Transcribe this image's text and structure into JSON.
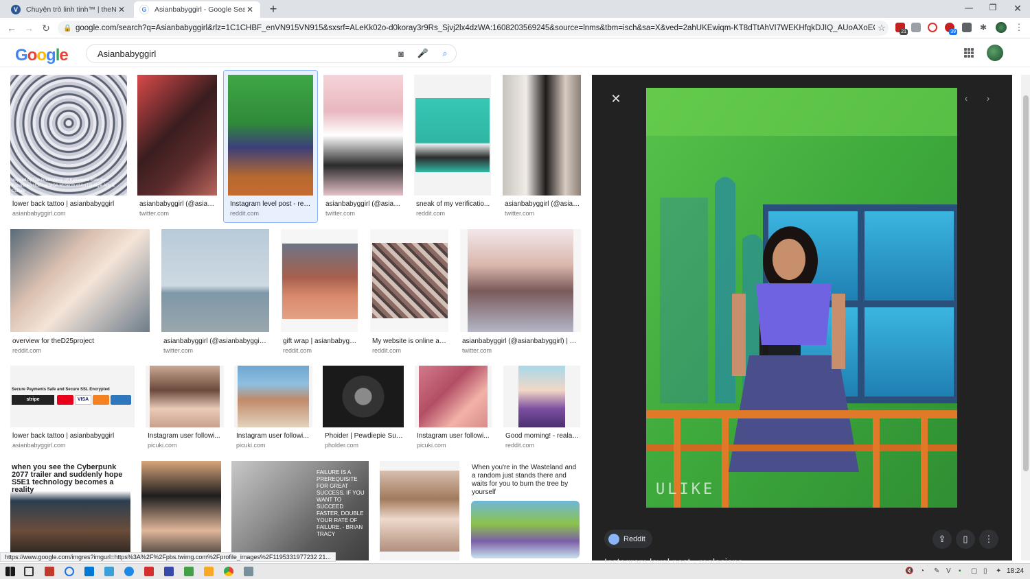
{
  "browser": {
    "tabs": [
      {
        "title": "Chuyện trò linh tinh™ | theNEXTv",
        "favicon": "thenextvoz-icon",
        "color": "#2b5797",
        "active": false
      },
      {
        "title": "Asianbabyggirl - Google Search",
        "favicon": "google-icon",
        "color": "#4285f4",
        "active": true
      }
    ],
    "url": "google.com/search?q=Asianbabyggirl&rlz=1C1CHBF_enVN915VN915&sxsrf=ALeKk02o-d0koray3r9Rs_Sjvj2lx4dzWA:1608203569245&source=lnms&tbm=isch&sa=X&ved=2ahUKEwiqm-KT8dTtAhVI7WEKHfqkDJIQ_AUoAXoECAYQAw&b...",
    "extension_badges": [
      "21",
      "39"
    ]
  },
  "google": {
    "query": "Asianbabyggirl",
    "logo_letters": [
      "G",
      "o",
      "o",
      "g",
      "l",
      "e"
    ]
  },
  "results": [
    {
      "caption": "lower back tattoo | asianbabyggirl",
      "source": "asianbabyggirl.com",
      "overlay": "Inspired by The Great Wave off Kanagawa from the... Katsushika Hokusai MOA Museum of Art | Google Arts & Culture"
    },
    {
      "caption": "asianbabyggirl (@asian...",
      "source": "twitter.com"
    },
    {
      "caption": "Instagram level post - rea...",
      "source": "reddit.com"
    },
    {
      "caption": "asianbabyggirl (@asian...",
      "source": "twitter.com"
    },
    {
      "caption": "sneak of my verificatio...",
      "source": "reddit.com"
    },
    {
      "caption": "asianbabyggirl (@asian...",
      "source": "twitter.com"
    },
    {
      "caption": "overview for theD25project",
      "source": "reddit.com"
    },
    {
      "caption": "asianbabyggirl (@asianbabyggirl)...",
      "source": "twitter.com"
    },
    {
      "caption": "gift wrap | asianbabygg...",
      "source": "reddit.com"
    },
    {
      "caption": "My website is online an...",
      "source": "reddit.com"
    },
    {
      "caption": "asianbabyggirl (@asianbabyggirl) | Tw...",
      "source": "twitter.com"
    },
    {
      "caption": "lower back tattoo | asianbabyggirl",
      "source": "asianbabyggirl.com",
      "overlay": "Secure Payments   Safe and Secure SSL Encrypted"
    },
    {
      "caption": "Instagram user followi...",
      "source": "picuki.com"
    },
    {
      "caption": "Instagram user followi...",
      "source": "picuki.com"
    },
    {
      "caption": "Phoider | Pewdiepie Sub...",
      "source": "pholder.com"
    },
    {
      "caption": "Instagram user followi...",
      "source": "picuki.com"
    },
    {
      "caption": "Good morning! - realasi...",
      "source": "reddit.com"
    },
    {
      "overlay": "when you see the Cyberpunk 2077 trailer and suddenly hope S5E1 technology becomes a reality"
    },
    {},
    {
      "overlay": "FAILURE IS A PREREQUISITE FOR GREAT SUCCESS. IF YOU WANT TO SUCCEED FASTER, DOUBLE YOUR RATE OF FAILURE. - BRIAN TRACY"
    },
    {},
    {
      "overlay": "When you're in the Wasteland and a random just stands there and waits for you to burn the tree by yourself"
    }
  ],
  "preview": {
    "source": "Reddit",
    "title": "Instagram level post - realasians",
    "watermark": "ULIKE"
  },
  "status_url": "https://www.google.com/imgres?imgurl=https%3A%2F%2Fpbs.twimg.com%2Fprofile_images%2F1195331977232 21...",
  "taskbar": {
    "clock": "18:24"
  }
}
